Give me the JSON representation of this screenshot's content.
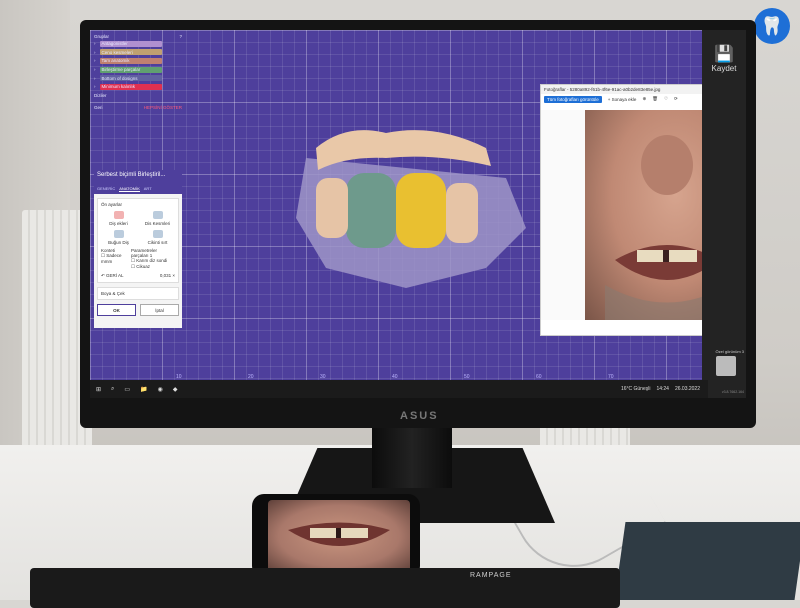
{
  "monitor": {
    "brand": "ASUS"
  },
  "app": {
    "save_label": "Kaydet",
    "layers": {
      "header": "Gruplar",
      "items": [
        {
          "label": "Antagonistler",
          "color": "#b090d0"
        },
        {
          "label": "Ceno kesmeleri",
          "color": "#c0a070"
        },
        {
          "label": "Tam anatomik",
          "color": "#c08070"
        },
        {
          "label": "Birleştirme parçalar",
          "color": "#60a070"
        },
        {
          "label": "Bottom of dosigns",
          "color": "#6060a0"
        },
        {
          "label": "Minimum kalınlık",
          "color": "#e03050"
        }
      ],
      "misc": [
        "Diziler",
        "Geri"
      ],
      "hide_link": "HEPSİNİ GÖSTER"
    },
    "dialog": {
      "title": "Serbest biçimli Birleştiril...",
      "tabs": [
        "GENERİC",
        "ANATOMİK",
        "ART"
      ],
      "section": "Ön ayarlar",
      "tools": [
        "Diş ekleri",
        "Dis Kesmleri",
        "Buğun Diş",
        "Cikinti sırt"
      ],
      "options_left": [
        "Konteti",
        "Sadece mmm"
      ],
      "options_right": [
        "Parametreler parçaları 1",
        "Karım diz sondi",
        "Cikuaz"
      ],
      "undo": "GERİ AL",
      "value": "0,031 ×",
      "section2": "Boya & Çek",
      "ok": "OK",
      "cancel": "İptal"
    },
    "photo": {
      "title": "Fotoğraflar - 5280a892-f61b-4f6e-91ac-a0b2de83e85e.jpg",
      "all_photos": "Tüm fotoğrafları görüntüle",
      "add": "Sonaya ekle"
    },
    "axis_ticks": [
      "10",
      "20",
      "30",
      "40",
      "50",
      "60",
      "70"
    ],
    "nav_label": "Özel görünüm 3",
    "version": "v3.8.7662.164"
  },
  "taskbar": {
    "weather": "16°C Güneşli",
    "time": "14:24",
    "date": "26.03.2022"
  },
  "keyboard": {
    "brand": "RAMPAGE"
  }
}
